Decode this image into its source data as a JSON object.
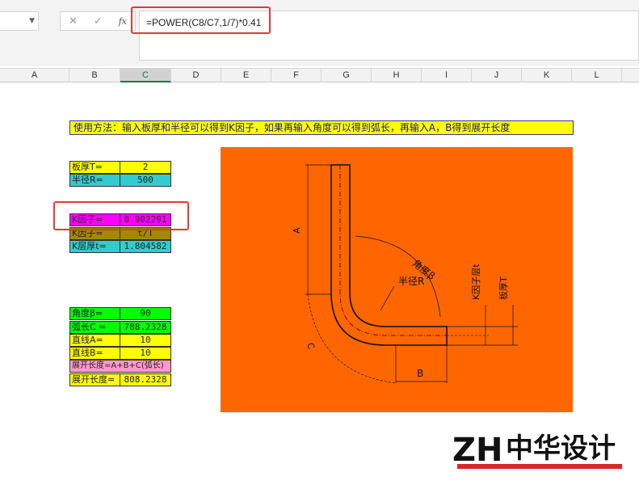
{
  "formula_bar": {
    "formula": "=POWER(C8/C7,1/7)*0.41",
    "name_box": "",
    "fx_label": "fx"
  },
  "columns": [
    "A",
    "B",
    "C",
    "D",
    "E",
    "F",
    "G",
    "H",
    "I",
    "J",
    "K",
    "L"
  ],
  "selected_column": "C",
  "sheet": {
    "instruction": "使用方法：输入板厚和半径可以得到K因子，如果再输入角度可以得到弧长，再输入A，B得到展开长度",
    "inputs": [
      {
        "label": "板厚T=",
        "value": "2"
      },
      {
        "label": "半径R=",
        "value": "500"
      }
    ],
    "k_rows": [
      {
        "label": "K因子=",
        "value": "0.902291"
      },
      {
        "label": "K因子=",
        "value": "t/T"
      },
      {
        "label": "K层厚t=",
        "value": "1.804582"
      }
    ],
    "calc_rows": [
      {
        "label": "角度β=",
        "value": "90"
      },
      {
        "label": "弧长C =",
        "value": "788.2328"
      },
      {
        "label": "直线A=",
        "value": "10"
      },
      {
        "label": "直线B=",
        "value": "10"
      },
      {
        "label": "展开长度=A+B+C(弧长)",
        "value": ""
      },
      {
        "label": "展开长度=",
        "value": "808.2328"
      }
    ]
  },
  "drawing": {
    "label_a": "A",
    "label_b": "B",
    "label_c": "C",
    "label_angle": "角度β",
    "label_radius": "半径R",
    "label_kfactor_layer": "K因子层t",
    "label_thickness": "板厚T"
  },
  "logo": {
    "text": "中华设计",
    "mark": "ZH"
  },
  "colors": {
    "highlight_red": "#e53935",
    "drawing_bg": "#ff6600",
    "cell_yellow": "#ffff00",
    "cell_cyan": "#33cccc",
    "cell_magenta": "#ff00ff",
    "cell_green": "#00ff00",
    "cell_pink": "#ff99cc"
  }
}
